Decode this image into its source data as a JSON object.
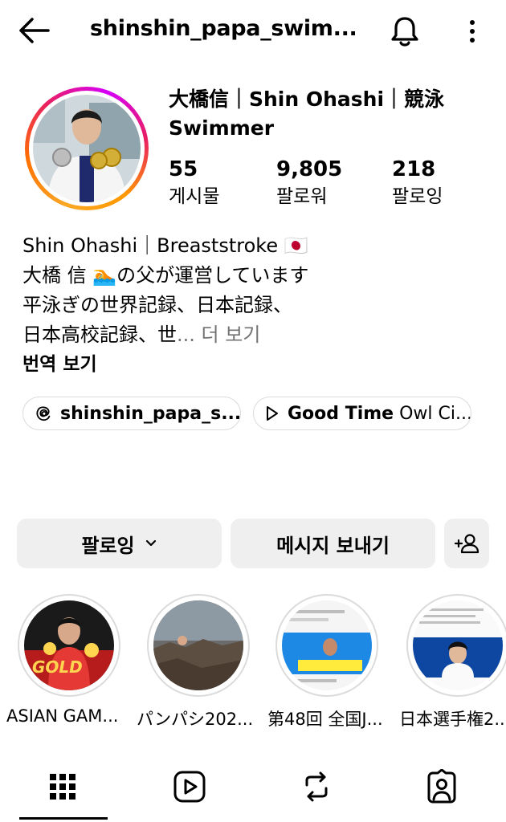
{
  "header": {
    "username": "shinshin_papa_swim...",
    "back_icon": "arrow-left-icon",
    "notification_icon": "bell-icon",
    "more_icon": "more-vertical-icon"
  },
  "profile": {
    "full_name_line1": "大橋信｜Shin Ohashi｜競泳",
    "full_name_line2": "Swimmer",
    "stats": [
      {
        "value": "55",
        "label": "게시물"
      },
      {
        "value": "9,805",
        "label": "팔로워"
      },
      {
        "value": "218",
        "label": "팔로잉"
      }
    ]
  },
  "bio": {
    "line1": "Shin Ohashi｜Breaststroke 🇯🇵",
    "line2": "大橋 信 🏊の父が運営しています",
    "line3": "平泳ぎの世界記録、日本記録、",
    "line4_text": "日本高校記録、世",
    "line4_more": "... 더 보기",
    "translate": "번역 보기"
  },
  "chips": {
    "threads": "shinshin_papa_s...",
    "music_bold": "Good Time",
    "music_rest": " Owl Ci..."
  },
  "buttons": {
    "following": "팔로잉",
    "message": "메시지 보내기",
    "add_person_icon": "add-person-icon"
  },
  "highlights": [
    {
      "label": "ASIAN GAM...",
      "thumb_text": "GOLD"
    },
    {
      "label": "パンパシ202..."
    },
    {
      "label": "第48回 全国J..."
    },
    {
      "label": "日本選手権2..."
    }
  ],
  "tabs": [
    "grid-icon",
    "reels-icon",
    "reposts-icon",
    "tagged-icon"
  ],
  "colors": {
    "button_bg": "#efefef",
    "secondary_text": "#737373",
    "border": "#dbdbdb",
    "story_ring": "#e91e63"
  }
}
